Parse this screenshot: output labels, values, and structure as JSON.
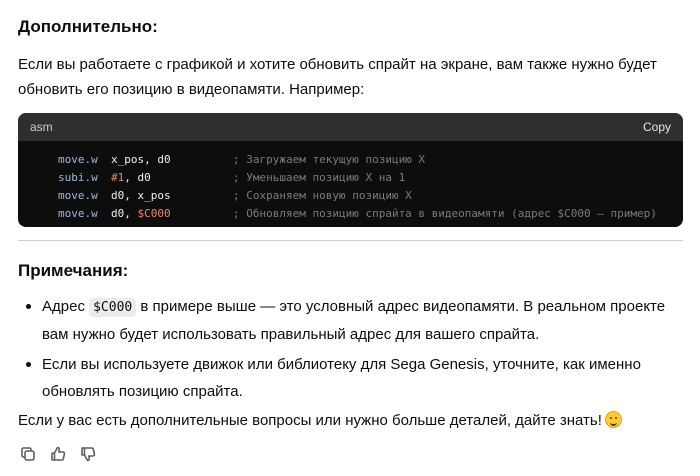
{
  "section1": {
    "heading": "Дополнительно:",
    "paragraph": "Если вы работаете с графикой и хотите обновить спрайт на экране, вам также нужно будет обновить его позицию в видеопамяти. Например:"
  },
  "code_block": {
    "language": "asm",
    "copy_label": "Copy",
    "lines": [
      {
        "op": "move.w",
        "a": "x_pos",
        "sep": ", ",
        "b": "d0",
        "b_type": "id",
        "a_type": "id",
        "comment": "; Загружаем текущую позицию X"
      },
      {
        "op": "subi.w",
        "a": "#1",
        "sep": ", ",
        "b": "d0",
        "b_type": "id",
        "a_type": "num",
        "comment": "; Уменьшаем позицию X на 1"
      },
      {
        "op": "move.w",
        "a": "d0",
        "sep": ", ",
        "b": "x_pos",
        "b_type": "id",
        "a_type": "id",
        "comment": "; Сохраняем новую позицию X"
      },
      {
        "op": "move.w",
        "a": "d0",
        "sep": ", ",
        "b": "$C000",
        "b_type": "num",
        "a_type": "id",
        "comment": "; Обновляем позицию спрайта в видеопамяти (адрес $C000 – пример)"
      }
    ]
  },
  "section2": {
    "heading": "Примечания:",
    "bullet1": {
      "before": "Адрес ",
      "code": "$C000",
      "after": " в примере выше — это условный адрес видеопамяти. В реальном проекте вам нужно будет использовать правильный адрес для вашего спрайта."
    },
    "bullet2": "Если вы используете движок или библиотеку для Sega Genesis, уточните, как именно обновлять позицию спрайта."
  },
  "closing": "Если у вас есть дополнительные вопросы или нужно больше деталей, дайте знать!",
  "icons": {
    "copy": "copy-icon",
    "like": "thumbs-up-icon",
    "dislike": "thumbs-down-icon",
    "emoji": "smiling-face-emoji"
  },
  "colors": {
    "code_bg": "#0d0d0d",
    "code_header_bg": "#2f2f2f",
    "keyword": "#9cb8e8",
    "number": "#e48a6e",
    "comment": "#7b7b7b"
  }
}
